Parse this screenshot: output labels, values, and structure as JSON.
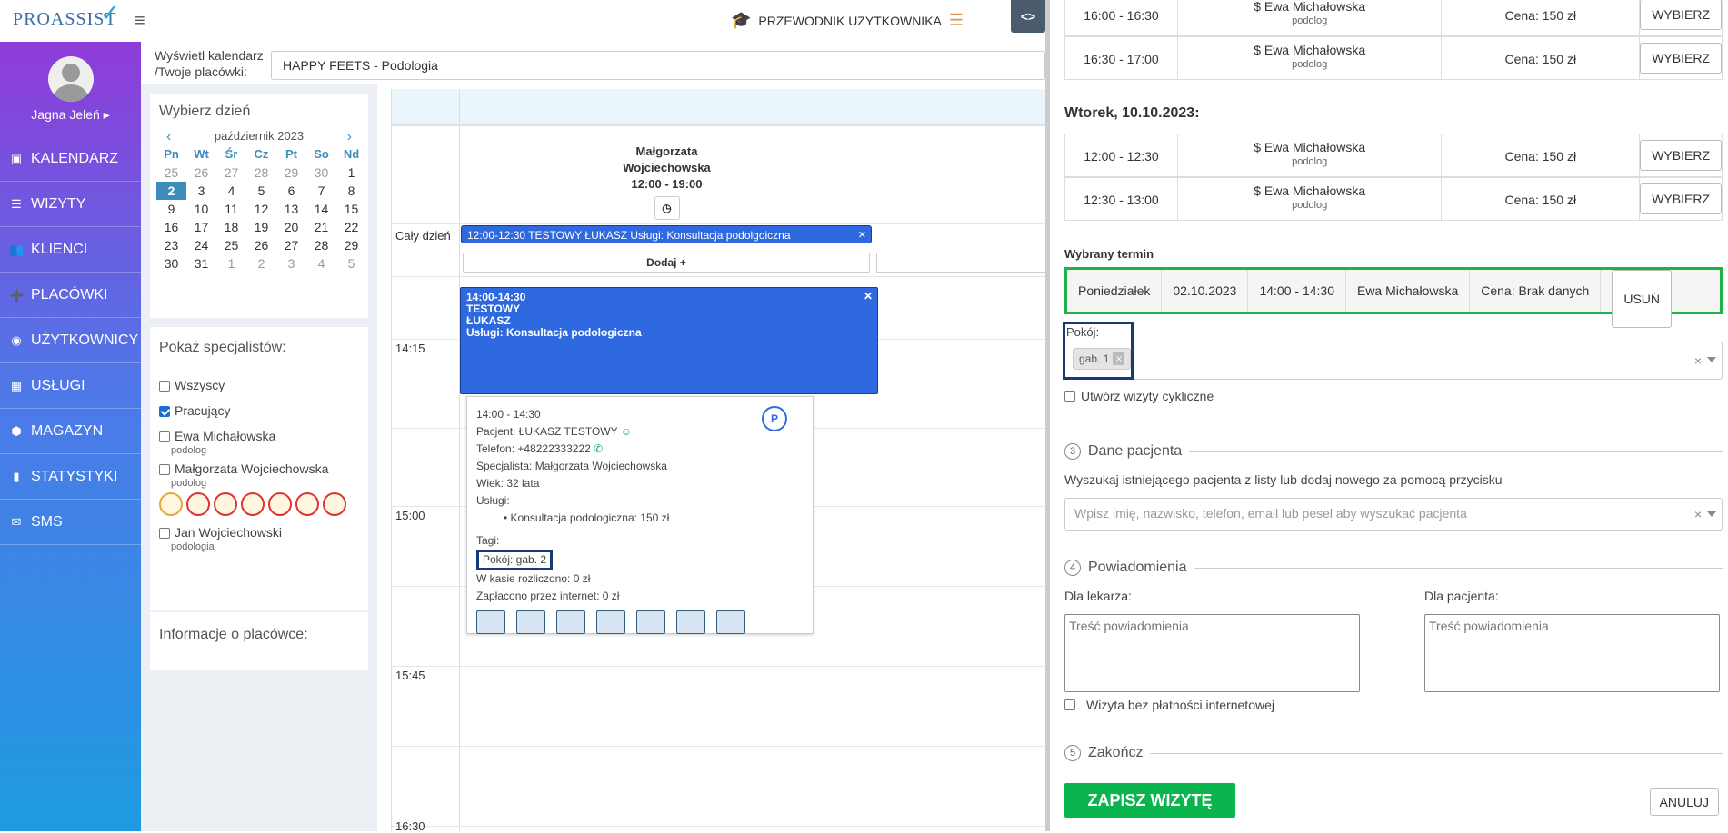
{
  "header": {
    "logo": "PROASSIST",
    "guide_label": "PRZEWODNIK UŻYTKOWNIKA",
    "toggle": "<>"
  },
  "user": {
    "name": "Jagna Jeleń ▸"
  },
  "nav": [
    {
      "label": "KALENDARZ",
      "icon": "calendar-icon",
      "glyph": "▣"
    },
    {
      "label": "WIZYTY",
      "icon": "list-icon",
      "glyph": "☰"
    },
    {
      "label": "KLIENCI",
      "icon": "users-icon",
      "glyph": "👥"
    },
    {
      "label": "PLACÓWKI",
      "icon": "user-plus-icon",
      "glyph": "➕"
    },
    {
      "label": "UŻYTKOWNICY",
      "icon": "user-circle-icon",
      "glyph": "◉"
    },
    {
      "label": "USŁUGI",
      "icon": "grid-icon",
      "glyph": "▦"
    },
    {
      "label": "MAGAZYN",
      "icon": "box-icon",
      "glyph": "⬢"
    },
    {
      "label": "STATYSTYKI",
      "icon": "bar-chart-icon",
      "glyph": "▮"
    },
    {
      "label": "SMS",
      "icon": "sms-icon",
      "glyph": "✉"
    }
  ],
  "filter": {
    "label1": "Wyświetl kalendarz",
    "label2": "/Twoje placówki:",
    "value": "HAPPY FEETS - Podologia"
  },
  "datepicker": {
    "title": "Wybierz dzień",
    "month": "październik 2023",
    "prev": "‹",
    "next": "›",
    "weekdays": [
      "Pn",
      "Wt",
      "Śr",
      "Cz",
      "Pt",
      "So",
      "Nd"
    ],
    "rows": [
      [
        "25",
        "26",
        "27",
        "28",
        "29",
        "30",
        "1"
      ],
      [
        "2",
        "3",
        "4",
        "5",
        "6",
        "7",
        "8"
      ],
      [
        "9",
        "10",
        "11",
        "12",
        "13",
        "14",
        "15"
      ],
      [
        "16",
        "17",
        "18",
        "19",
        "20",
        "21",
        "22"
      ],
      [
        "23",
        "24",
        "25",
        "26",
        "27",
        "28",
        "29"
      ],
      [
        "30",
        "31",
        "1",
        "2",
        "3",
        "4",
        "5"
      ]
    ]
  },
  "specialists": {
    "title": "Pokaż specjalistów:",
    "items": [
      {
        "label": "Wszyscy",
        "checked": false,
        "sub": ""
      },
      {
        "label": "Pracujący",
        "checked": true,
        "sub": ""
      },
      {
        "label": "Ewa Michałowska",
        "checked": false,
        "sub": "podolog"
      },
      {
        "label": "Małgorzata Wojciechowska",
        "checked": false,
        "sub": "podolog"
      },
      {
        "label": "Jan Wojciechowski",
        "checked": false,
        "sub": "podologia"
      }
    ]
  },
  "facility_info": {
    "title": "Informacje o placówce:"
  },
  "calendar": {
    "specialist_name1": "Małgorzata",
    "specialist_name2": "Wojciechowska",
    "hours": "12:00 - 19:00",
    "clock": "◷",
    "allday_label": "Cały dzień",
    "allday_event": "12:00-12:30 TESTOWY ŁUKASZ Usługi: Konsultacja podolgoiczna",
    "add_label": "Dodaj +",
    "times": [
      "14:15",
      "15:00",
      "15:45",
      "16:30"
    ],
    "event": {
      "time": "14:00-14:30",
      "l1": "TESTOWY",
      "l2": "ŁUKASZ",
      "l3": "Usługi: Konsultacja podologiczna"
    },
    "popup": {
      "time": "14:00 - 14:30",
      "patient": "Pacjent: ŁUKASZ TESTOWY",
      "phone": "Telefon: +48222333222",
      "specialist": "Specjalista: Małgorzata Wojciechowska",
      "age": "Wiek: 32 lata",
      "services_label": "Usługi:",
      "service": "Konsultacja podologiczna: 150 zł",
      "tags": "Tagi:",
      "room": "Pokój: gab. 2",
      "cash": "W kasie rozliczono: 0 zł",
      "online": "Zapłacono przez internet: 0 zł",
      "badge": "P"
    }
  },
  "slots_top": [
    {
      "time": "16:00 - 16:30",
      "name": "$ Ewa Michałowska",
      "role": "podolog",
      "price": "Cena: 150 zł",
      "btn": "WYBIERZ"
    },
    {
      "time": "16:30 - 17:00",
      "name": "$ Ewa Michałowska",
      "role": "podolog",
      "price": "Cena: 150 zł",
      "btn": "WYBIERZ"
    }
  ],
  "day2": "Wtorek, 10.10.2023:",
  "slots_day2": [
    {
      "time": "12:00 - 12:30",
      "name": "$ Ewa Michałowska",
      "role": "podolog",
      "price": "Cena: 150 zł",
      "btn": "WYBIERZ"
    },
    {
      "time": "12:30 - 13:00",
      "name": "$ Ewa Michałowska",
      "role": "podolog",
      "price": "Cena: 150 zł",
      "btn": "WYBIERZ"
    }
  ],
  "selected": {
    "title": "Wybrany termin",
    "day": "Poniedziałek",
    "date": "02.10.2023",
    "time": "14:00 - 14:30",
    "name": "Ewa Michałowska",
    "price": "Cena: Brak danych",
    "remove": "USUŃ"
  },
  "room": {
    "label": "Pokój:",
    "chip": "gab. 1",
    "chip_x": "×",
    "clear": "×"
  },
  "cyclic": "Utwórz wizyty cykliczne",
  "sec3": {
    "n": "3",
    "title": "Dane pacjenta",
    "hint": "Wyszukaj istniejącego pacjenta z listy lub dodaj nowego za pomocą przycisku",
    "placeholder": "Wpisz imię, nazwisko, telefon, email lub pesel aby wyszukać pacjenta"
  },
  "sec4": {
    "n": "4",
    "title": "Powiadomienia",
    "doctor": "Dla lekarza:",
    "patient": "Dla pacjenta:",
    "ph": "Treść powiadomienia",
    "nopay": "Wizyta bez płatności internetowej"
  },
  "sec5": {
    "n": "5",
    "title": "Zakończ"
  },
  "actions": {
    "save": "ZAPISZ WIZYTĘ",
    "cancel": "ANULUJ"
  }
}
